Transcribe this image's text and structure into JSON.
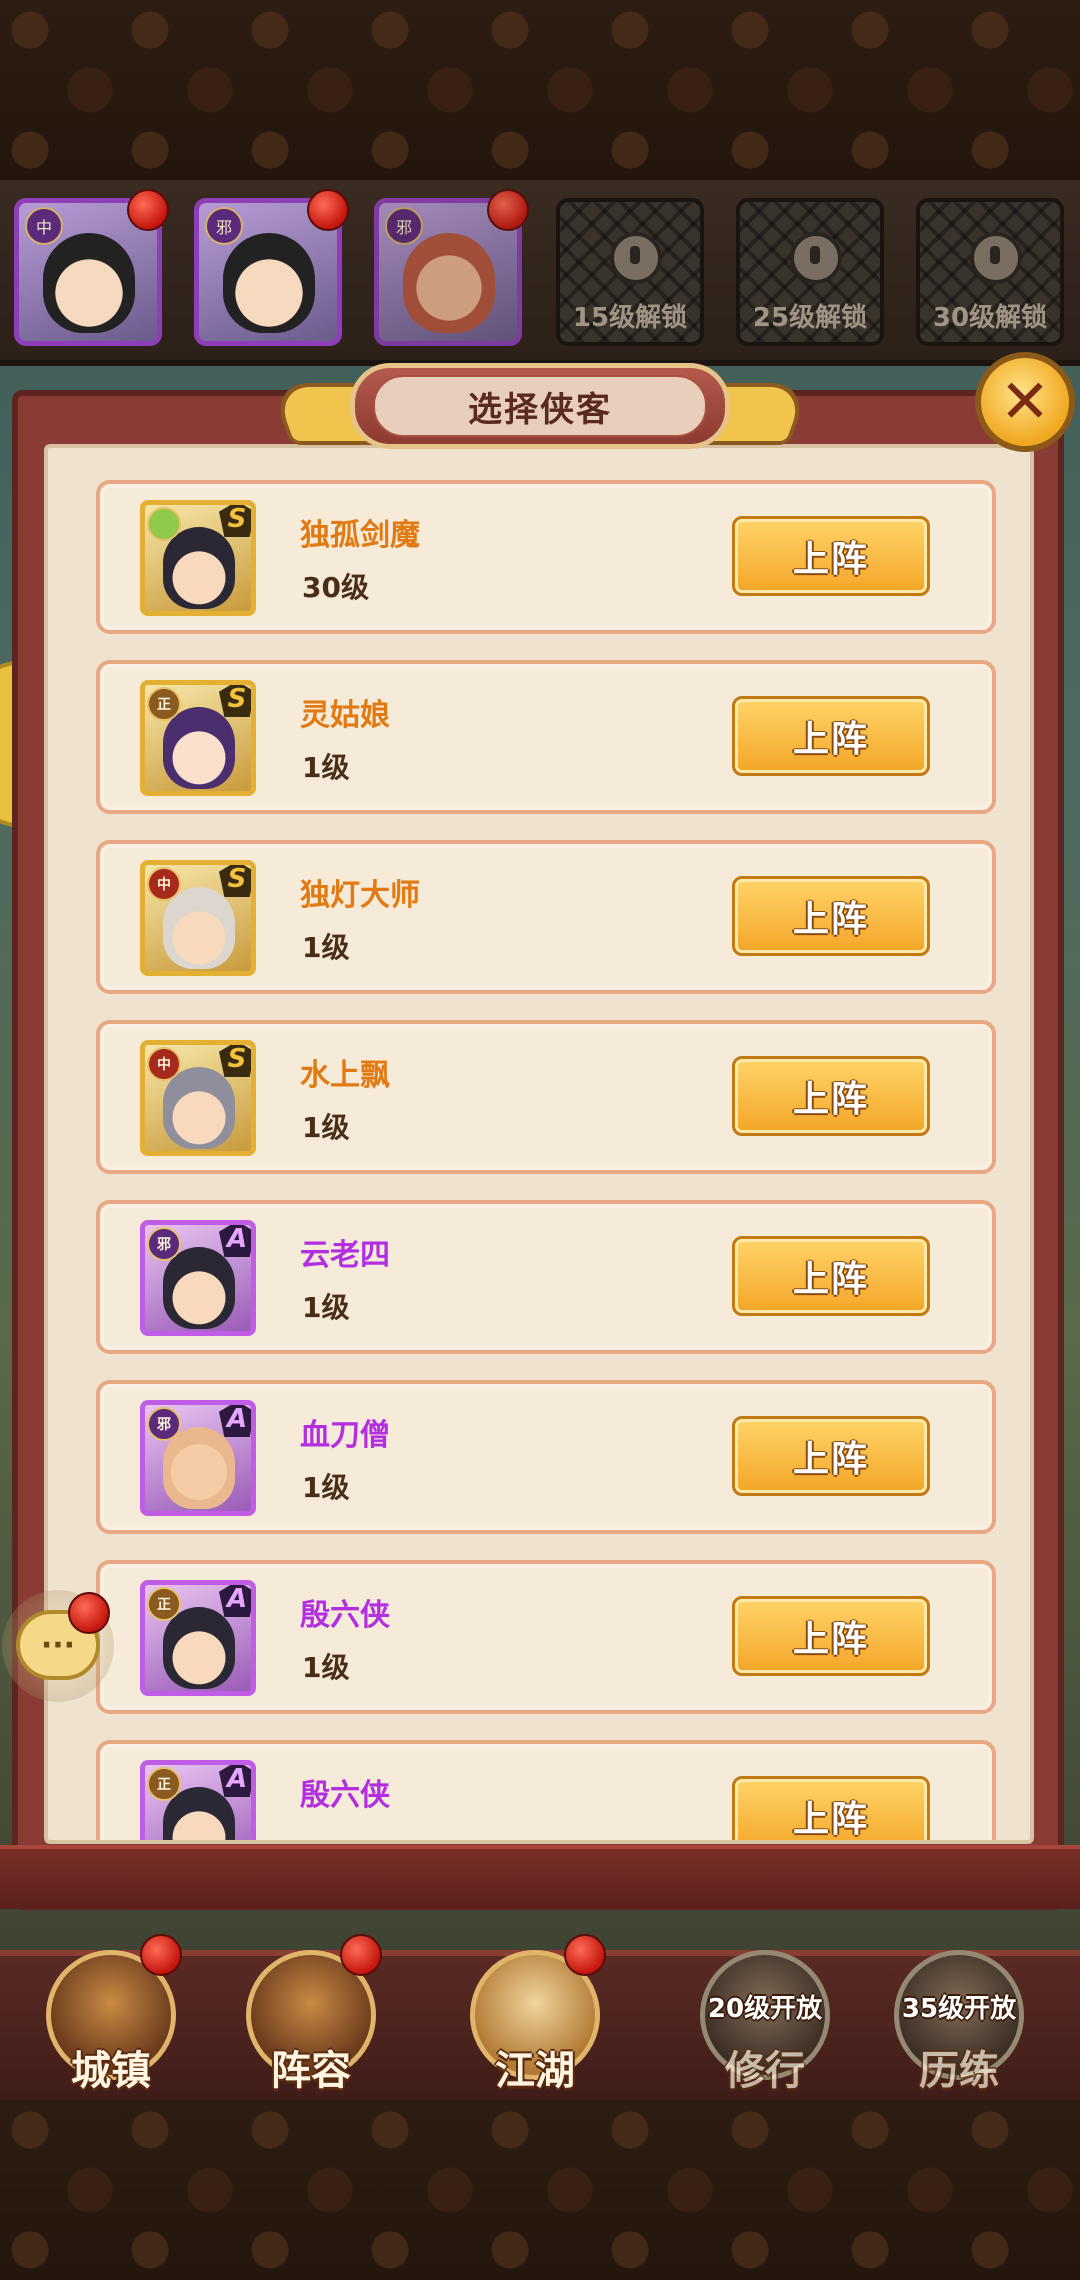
{
  "hero_strip": {
    "slots": [
      {
        "faction": "中",
        "locked": false
      },
      {
        "faction": "邪",
        "locked": false
      },
      {
        "faction": "邪",
        "locked": false
      },
      {
        "locked": true,
        "unlock_text": "15级解锁"
      },
      {
        "locked": true,
        "unlock_text": "25级解锁"
      },
      {
        "locked": true,
        "unlock_text": "30级解锁"
      }
    ]
  },
  "panel": {
    "title": "选择侠客",
    "close_icon": "close-icon"
  },
  "heroes": [
    {
      "name": "独孤剑魔",
      "level": "30级",
      "faction": "",
      "rank": "S",
      "color": "orange",
      "button": "上阵"
    },
    {
      "name": "灵姑娘",
      "level": "1级",
      "faction": "正",
      "rank": "S",
      "color": "orange",
      "button": "上阵"
    },
    {
      "name": "独灯大师",
      "level": "1级",
      "faction": "中",
      "rank": "S",
      "color": "orange",
      "button": "上阵"
    },
    {
      "name": "水上飘",
      "level": "1级",
      "faction": "中",
      "rank": "S",
      "color": "orange",
      "button": "上阵"
    },
    {
      "name": "云老四",
      "level": "1级",
      "faction": "邪",
      "rank": "A",
      "color": "purple",
      "button": "上阵"
    },
    {
      "name": "血刀僧",
      "level": "1级",
      "faction": "邪",
      "rank": "A",
      "color": "purple",
      "button": "上阵"
    },
    {
      "name": "殷六侠",
      "level": "1级",
      "faction": "正",
      "rank": "A",
      "color": "purple",
      "button": "上阵"
    },
    {
      "name": "殷六侠",
      "level": "",
      "faction": "正",
      "rank": "A",
      "color": "purple",
      "button": "上阵"
    }
  ],
  "chat": {
    "icon": "chat-icon",
    "dots": "···"
  },
  "nav": {
    "items": [
      {
        "label": "城镇",
        "open_level": "",
        "badge": true
      },
      {
        "label": "阵容",
        "open_level": "",
        "badge": true
      },
      {
        "label": "江湖",
        "open_level": "",
        "badge": true
      },
      {
        "label": "修行",
        "open_level": "20级开放",
        "badge": false
      },
      {
        "label": "历练",
        "open_level": "35级开放",
        "badge": false
      }
    ]
  },
  "colors": {
    "rare_name": "#e27a14",
    "epic_name": "#b22ee0",
    "button_gold": "#f3a526",
    "panel_bg": "#efe2cf",
    "frame_red": "#8a3b33"
  }
}
